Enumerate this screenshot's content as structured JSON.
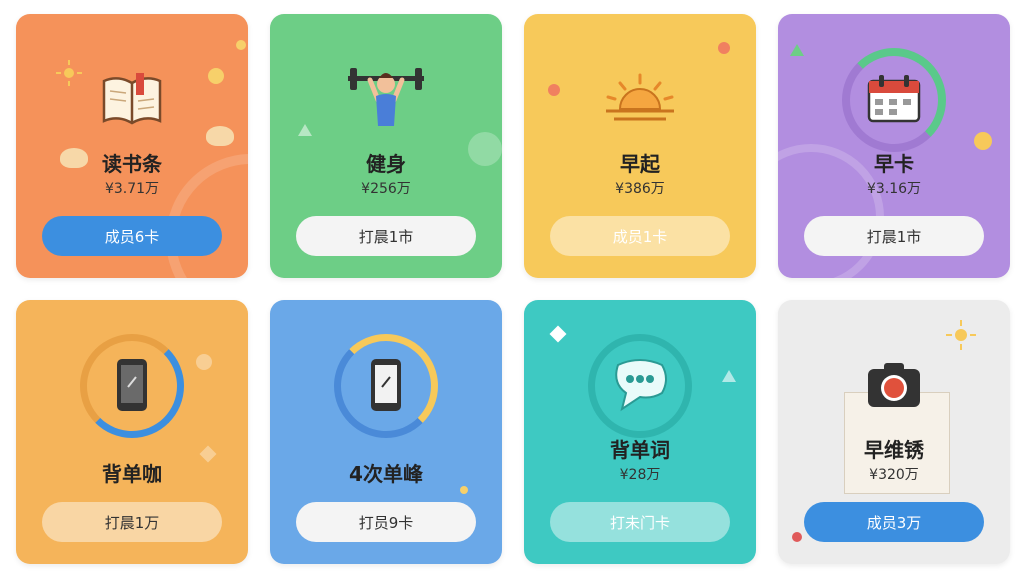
{
  "cards": [
    {
      "title": "读书条",
      "count": "¥3.71万",
      "button": "成员6卡",
      "icon": "book-icon"
    },
    {
      "title": "健身",
      "count": "¥256万",
      "button": "打晨1市",
      "icon": "fitness-icon"
    },
    {
      "title": "早起",
      "count": "¥386万",
      "button": "成员1卡",
      "icon": "sunrise-icon"
    },
    {
      "title": "早卡",
      "count": "¥3.16万",
      "button": "打晨1市",
      "icon": "calendar-icon"
    },
    {
      "title": "背单咖",
      "count": "",
      "button": "打晨1万",
      "icon": "phone-icon"
    },
    {
      "title": "4次单峰",
      "count": "",
      "button": "打员9卡",
      "icon": "phone-icon"
    },
    {
      "title": "背单词",
      "count": "¥28万",
      "button": "打未门卡",
      "icon": "chat-icon"
    },
    {
      "title": "早维锈",
      "count": "¥320万",
      "button": "成员3万",
      "icon": "camera-icon"
    }
  ],
  "colors": {
    "orange": "#f5925a",
    "green": "#6dce86",
    "yellow": "#f7c95a",
    "purple": "#b28ee0",
    "amber": "#f5b45a",
    "blue": "#6aa8e8",
    "teal": "#3ec9c2",
    "gray": "#ececec",
    "button_blue": "#3c8fe0"
  }
}
